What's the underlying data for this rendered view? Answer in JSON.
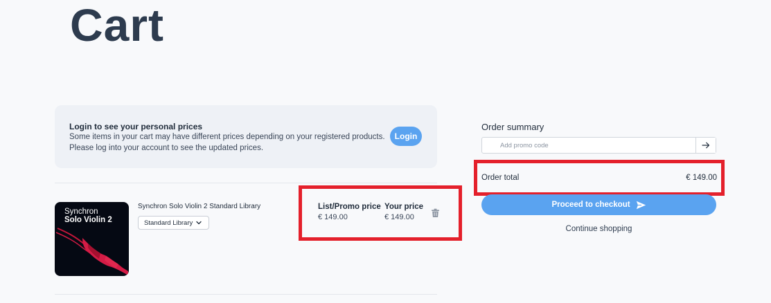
{
  "page": {
    "title": "Cart"
  },
  "login_banner": {
    "heading": "Login to see your personal prices",
    "line1": "Some items in your cart may have different prices depending on your registered products.",
    "line2": "Please log into your account to see the updated prices.",
    "button_label": "Login"
  },
  "cart_item": {
    "image_brand": "Synchron",
    "image_product": "Solo Violin 2",
    "name": "Synchron Solo Violin 2 Standard Library",
    "edition_selected": "Standard Library",
    "list_price_label": "List/Promo price",
    "list_price_value": "€ 149.00",
    "your_price_label": "Your price",
    "your_price_value": "€ 149.00"
  },
  "order_summary": {
    "title": "Order summary",
    "promo_placeholder": "Add promo code",
    "total_label": "Order total",
    "total_value": "€ 149.00",
    "checkout_label": "Proceed to checkout",
    "continue_label": "Continue shopping"
  },
  "colors": {
    "accent": "#5aa3f0",
    "highlight": "#e4202b",
    "title": "#2d3b4e",
    "banner_bg": "#eef1f6"
  },
  "icons": {
    "trash": "trash-icon",
    "chevron": "chevron-down-icon",
    "promo_arrow": "arrow-right-icon",
    "checkout": "send-icon"
  }
}
